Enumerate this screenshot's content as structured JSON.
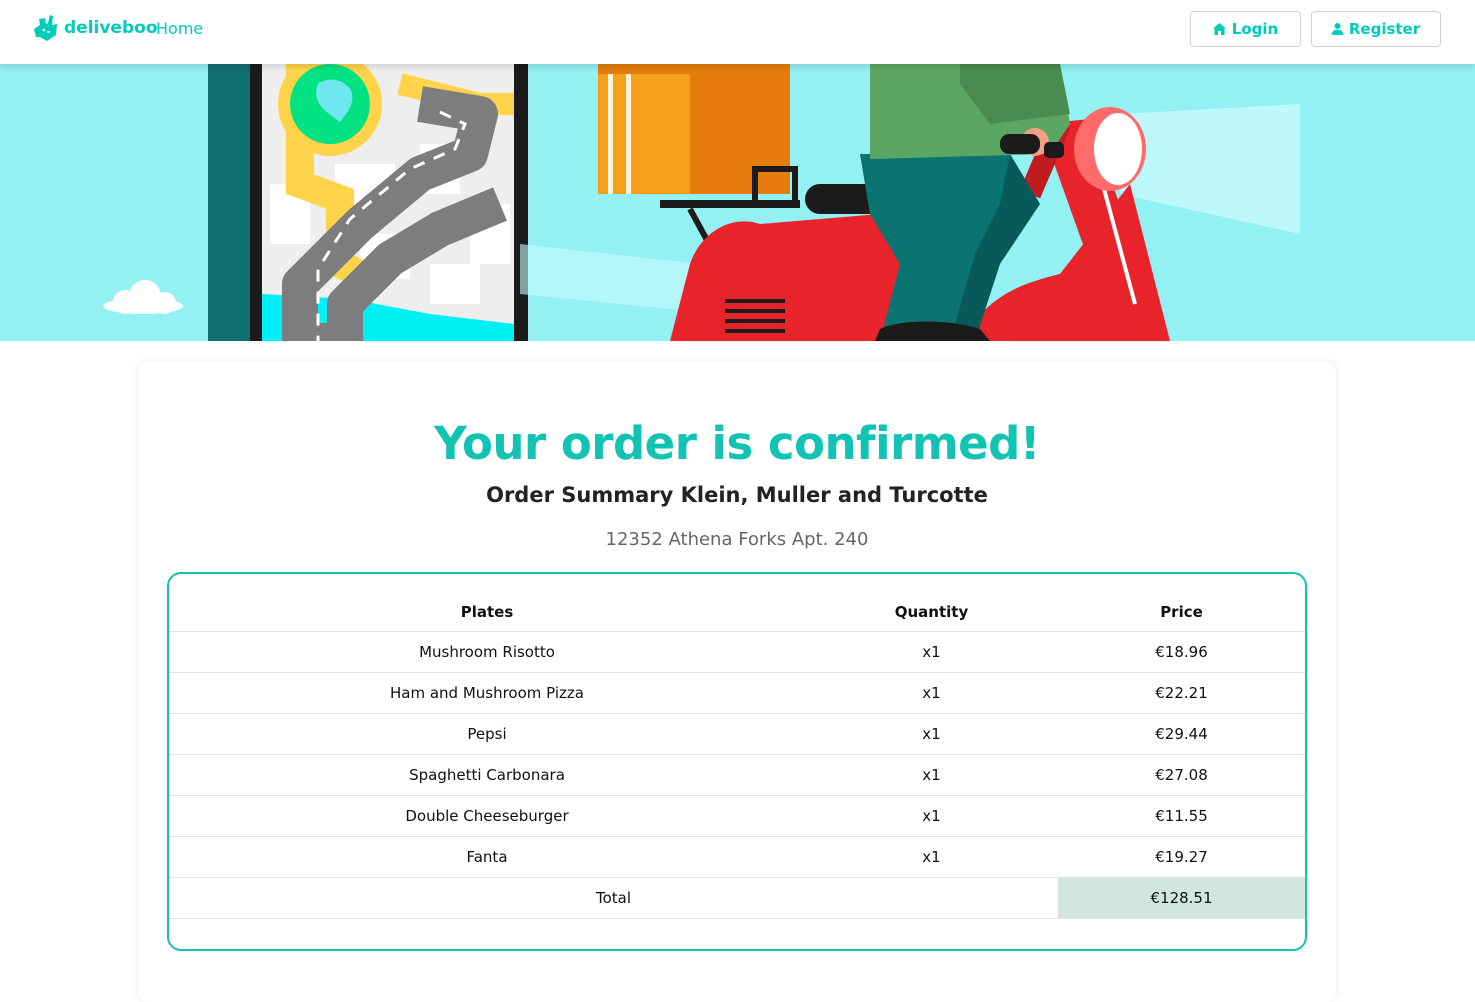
{
  "nav": {
    "brand": "deliveboo",
    "home": "Home",
    "login": "Login",
    "register": "Register"
  },
  "icons": {
    "brand": "deliveroo-kangaroo-logo",
    "login": "home-icon",
    "register": "user-icon"
  },
  "colors": {
    "accent": "#00ccbc",
    "hero_sky": "#93f0f3",
    "total_highlight": "#d1e7dd"
  },
  "order": {
    "title": "Your order is confirmed!",
    "summary": "Order Summary Klein, Muller and Turcotte",
    "address": "12352 Athena Forks Apt. 240",
    "columns": [
      "Plates",
      "Quantity",
      "Price"
    ],
    "items": [
      {
        "plate": "Mushroom Risotto",
        "quantity": "x1",
        "price": "€18.96"
      },
      {
        "plate": "Ham and Mushroom Pizza",
        "quantity": "x1",
        "price": "€22.21"
      },
      {
        "plate": "Pepsi",
        "quantity": "x1",
        "price": "€29.44"
      },
      {
        "plate": "Spaghetti Carbonara",
        "quantity": "x1",
        "price": "€27.08"
      },
      {
        "plate": "Double Cheeseburger",
        "quantity": "x1",
        "price": "€11.55"
      },
      {
        "plate": "Fanta",
        "quantity": "x1",
        "price": "€19.27"
      }
    ],
    "total_label": "Total",
    "total_value": "€128.51"
  }
}
